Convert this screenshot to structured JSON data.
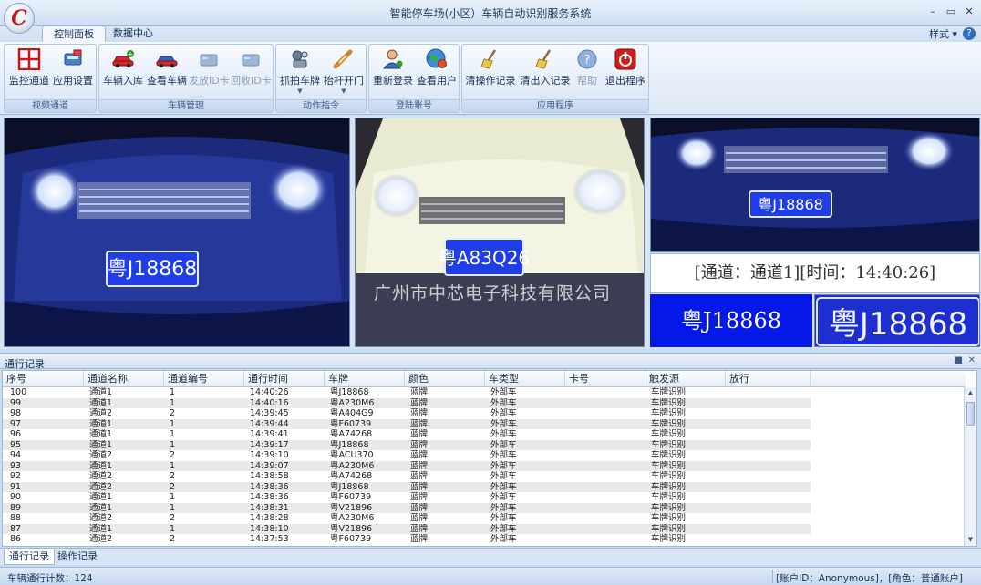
{
  "window": {
    "title": "智能停车场(小区）车辆自动识别服务系统",
    "logo_letter": "C"
  },
  "tabs": [
    {
      "label": "控制面板",
      "active": true
    },
    {
      "label": "数据中心",
      "active": false
    }
  ],
  "style_menu": "样式",
  "ribbon": {
    "groups": [
      {
        "label": "视频通道",
        "buttons": [
          {
            "label": "监控通道",
            "icon": "grid-icon",
            "disabled": false
          },
          {
            "label": "应用设置",
            "icon": "settings-icon",
            "disabled": false
          }
        ]
      },
      {
        "label": "车辆管理",
        "buttons": [
          {
            "label": "车辆入库",
            "icon": "car-add-icon",
            "disabled": false
          },
          {
            "label": "查看车辆",
            "icon": "car-view-icon",
            "disabled": false
          },
          {
            "label": "发放ID卡",
            "icon": "card-issue-icon",
            "disabled": true
          },
          {
            "label": "回收ID卡",
            "icon": "card-recycle-icon",
            "disabled": true
          }
        ]
      },
      {
        "label": "动作指令",
        "buttons": [
          {
            "label": "抓拍车牌",
            "icon": "camera-icon",
            "disabled": false,
            "dropdown": true
          },
          {
            "label": "抬杆开门",
            "icon": "barrier-icon",
            "disabled": false,
            "dropdown": true
          }
        ]
      },
      {
        "label": "登陆账号",
        "buttons": [
          {
            "label": "重新登录",
            "icon": "user-login-icon",
            "disabled": false
          },
          {
            "label": "查看用户",
            "icon": "globe-user-icon",
            "disabled": false
          }
        ]
      },
      {
        "label": "应用程序",
        "buttons": [
          {
            "label": "清操作记录",
            "icon": "broom-icon",
            "disabled": false
          },
          {
            "label": "清出入记录",
            "icon": "broom-icon",
            "disabled": false
          },
          {
            "label": "帮助",
            "icon": "help-icon",
            "disabled": true
          },
          {
            "label": "退出程序",
            "icon": "power-icon",
            "disabled": false
          }
        ]
      }
    ]
  },
  "video": {
    "cam1_plate": "粤J18868",
    "cam2_plate": "粤A83Q26",
    "cam3_plate": "粤J18868",
    "info_line": "[通道：通道1][时间：14:40:26]",
    "recognized_plate": "粤J18868",
    "crop_plate": "粤J18868",
    "watermark": "广州市中芯电子科技有限公司"
  },
  "records_panel": {
    "title": "通行记录",
    "columns": [
      "序号",
      "通道名称",
      "通道编号",
      "通行时间",
      "车牌",
      "颜色",
      "车类型",
      "卡号",
      "触发源",
      "放行"
    ],
    "rows": [
      [
        "100",
        "通道1",
        "1",
        "14:40:26",
        "粤J18868",
        "蓝牌",
        "外部车",
        "",
        "车牌识别",
        ""
      ],
      [
        "99",
        "通道1",
        "1",
        "14:40:16",
        "粤A230M6",
        "蓝牌",
        "外部车",
        "",
        "车牌识别",
        ""
      ],
      [
        "98",
        "通道2",
        "2",
        "14:39:45",
        "粤A404G9",
        "蓝牌",
        "外部车",
        "",
        "车牌识别",
        ""
      ],
      [
        "97",
        "通道1",
        "1",
        "14:39:44",
        "粤F60739",
        "蓝牌",
        "外部车",
        "",
        "车牌识别",
        ""
      ],
      [
        "96",
        "通道1",
        "1",
        "14:39:41",
        "粤A74268",
        "蓝牌",
        "外部车",
        "",
        "车牌识别",
        ""
      ],
      [
        "95",
        "通道1",
        "1",
        "14:39:17",
        "粤J18868",
        "蓝牌",
        "外部车",
        "",
        "车牌识别",
        ""
      ],
      [
        "94",
        "通道2",
        "2",
        "14:39:10",
        "粤ACU370",
        "蓝牌",
        "外部车",
        "",
        "车牌识别",
        ""
      ],
      [
        "93",
        "通道1",
        "1",
        "14:39:07",
        "粤A230M6",
        "蓝牌",
        "外部车",
        "",
        "车牌识别",
        ""
      ],
      [
        "92",
        "通道2",
        "2",
        "14:38:58",
        "粤A74268",
        "蓝牌",
        "外部车",
        "",
        "车牌识别",
        ""
      ],
      [
        "91",
        "通道2",
        "2",
        "14:38:36",
        "粤J18868",
        "蓝牌",
        "外部车",
        "",
        "车牌识别",
        ""
      ],
      [
        "90",
        "通道1",
        "1",
        "14:38:36",
        "粤F60739",
        "蓝牌",
        "外部车",
        "",
        "车牌识别",
        ""
      ],
      [
        "89",
        "通道1",
        "1",
        "14:38:31",
        "粤V21896",
        "蓝牌",
        "外部车",
        "",
        "车牌识别",
        ""
      ],
      [
        "88",
        "通道2",
        "2",
        "14:38:28",
        "粤A230M6",
        "蓝牌",
        "外部车",
        "",
        "车牌识别",
        ""
      ],
      [
        "87",
        "通道1",
        "1",
        "14:38:10",
        "粤V21896",
        "蓝牌",
        "外部车",
        "",
        "车牌识别",
        ""
      ],
      [
        "86",
        "通道2",
        "2",
        "14:37:53",
        "粤F60739",
        "蓝牌",
        "外部车",
        "",
        "车牌识别",
        ""
      ]
    ]
  },
  "bottom_tabs": [
    {
      "label": "通行记录",
      "active": true
    },
    {
      "label": "操作记录",
      "active": false
    }
  ],
  "status": {
    "count": "车辆通行计数：124",
    "account": "[账户ID：Anonymous]，[角色：普通账户]"
  },
  "colors": {
    "ribbon_bg": "#dbe7f6",
    "plate_blue": "#0418e8",
    "alt_row": "#e9e9e9"
  }
}
